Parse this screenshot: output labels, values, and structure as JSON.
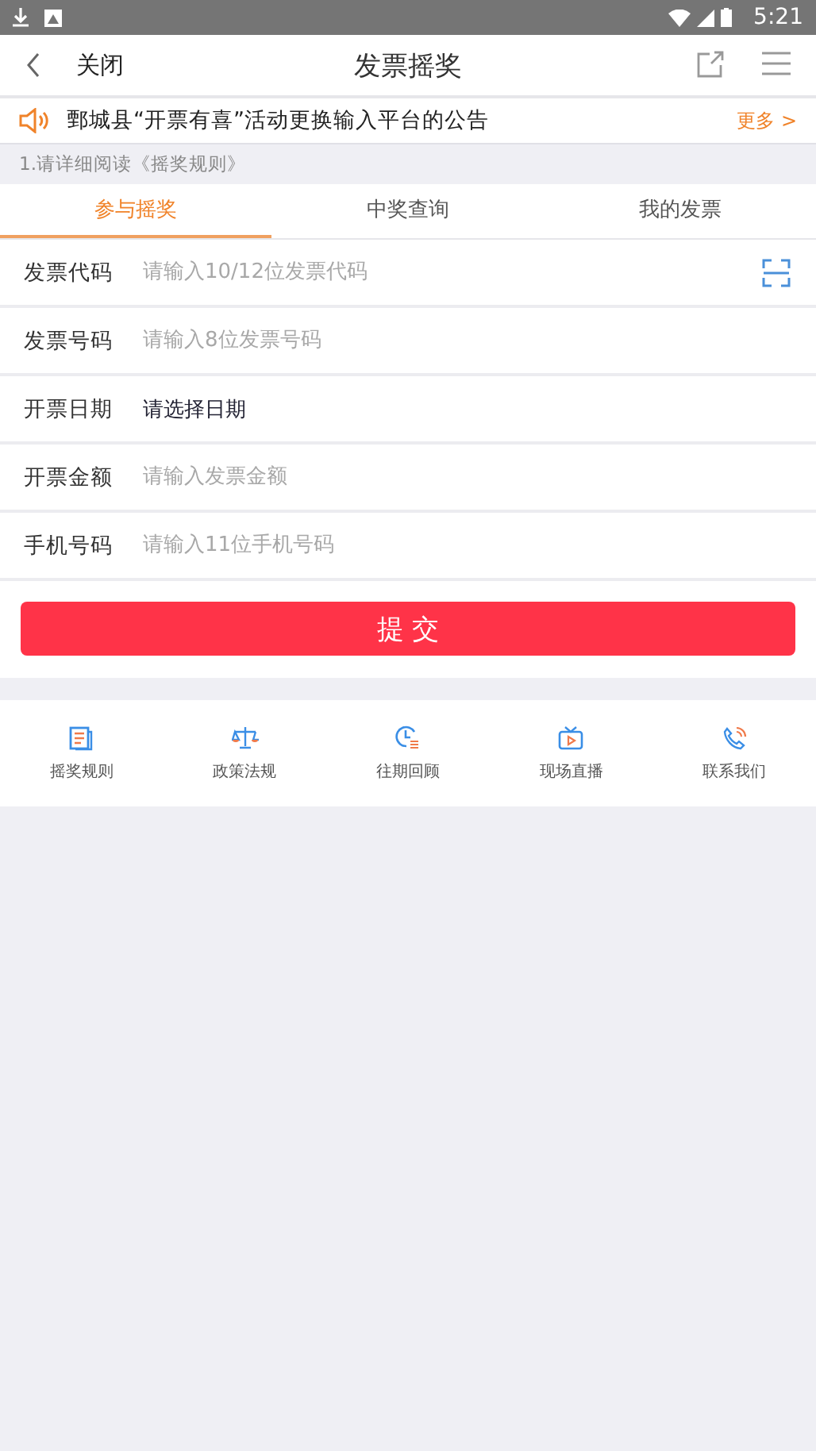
{
  "status_bar": {
    "time": "5:21"
  },
  "header": {
    "back_label": "关闭",
    "title": "发票摇奖"
  },
  "notice": {
    "text": "鄄城县“开票有喜”活动更换输入平台的公告",
    "more": "更多 >"
  },
  "hint": "1.请详细阅读《摇奖规则》",
  "tabs": [
    {
      "label": "参与摇奖",
      "selected": true
    },
    {
      "label": "中奖查询",
      "selected": false
    },
    {
      "label": "我的发票",
      "selected": false
    }
  ],
  "fields": [
    {
      "kind": "scan_input",
      "label": "发票代码",
      "placeholder": "请输入10/12位发票代码"
    },
    {
      "kind": "input",
      "label": "发票号码",
      "placeholder": "请输入8位发票号码"
    },
    {
      "kind": "picker",
      "label": "开票日期",
      "value": "请选择日期"
    },
    {
      "kind": "input",
      "label": "开票金额",
      "placeholder": "请输入发票金额"
    },
    {
      "kind": "input",
      "label": "手机号码",
      "placeholder": "请输入11位手机号码"
    }
  ],
  "submit": "提 交",
  "shortcuts": [
    {
      "kind": "rules",
      "label": "摇奖规则"
    },
    {
      "kind": "policy",
      "label": "政策法规"
    },
    {
      "kind": "history",
      "label": "往期回顾"
    },
    {
      "kind": "live",
      "label": "现场直播"
    },
    {
      "kind": "contact",
      "label": "联系我们"
    }
  ]
}
